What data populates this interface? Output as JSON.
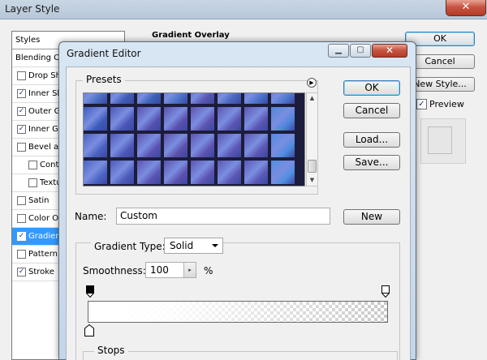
{
  "layer_style": {
    "title": "Layer Style",
    "close_glyph": "✕",
    "styles_header": "Styles",
    "items": [
      {
        "label": "Blending Op",
        "checkbox": false,
        "checked": false,
        "indent": 0,
        "selected": false
      },
      {
        "label": "Drop Sh",
        "checkbox": true,
        "checked": false,
        "indent": 0,
        "selected": false
      },
      {
        "label": "Inner Sh",
        "checkbox": true,
        "checked": true,
        "indent": 0,
        "selected": false
      },
      {
        "label": "Outer Gl",
        "checkbox": true,
        "checked": true,
        "indent": 0,
        "selected": false
      },
      {
        "label": "Inner Gl",
        "checkbox": true,
        "checked": true,
        "indent": 0,
        "selected": false
      },
      {
        "label": "Bevel and",
        "checkbox": true,
        "checked": false,
        "indent": 0,
        "selected": false
      },
      {
        "label": "Conto",
        "checkbox": true,
        "checked": false,
        "indent": 1,
        "selected": false
      },
      {
        "label": "Textu",
        "checkbox": true,
        "checked": false,
        "indent": 1,
        "selected": false
      },
      {
        "label": "Satin",
        "checkbox": true,
        "checked": false,
        "indent": 0,
        "selected": false
      },
      {
        "label": "Color Ov",
        "checkbox": true,
        "checked": false,
        "indent": 0,
        "selected": false
      },
      {
        "label": "Gradien",
        "checkbox": true,
        "checked": true,
        "indent": 0,
        "selected": true
      },
      {
        "label": "Pattern O",
        "checkbox": true,
        "checked": false,
        "indent": 0,
        "selected": false
      },
      {
        "label": "Stroke",
        "checkbox": true,
        "checked": true,
        "indent": 0,
        "selected": false
      }
    ],
    "group_title": "Gradient Overlay",
    "ok_label": "OK",
    "cancel_label": "Cancel",
    "new_style_label": "New Style...",
    "preview_label": "Preview",
    "preview_checked": true
  },
  "gradient_editor": {
    "title": "Gradient Editor",
    "min_glyph": "▁",
    "max_glyph": "▢",
    "close_glyph": "✕",
    "presets_label": "Presets",
    "presets_menu_glyph": "▶",
    "ok_label": "OK",
    "cancel_label": "Cancel",
    "load_label": "Load...",
    "save_label": "Save...",
    "name_label": "Name:",
    "name_value": "Custom",
    "new_label": "New",
    "gradient_type_label": "Gradient Type:",
    "gradient_type_value": "Solid",
    "smoothness_label": "Smoothness:",
    "smoothness_value": "100",
    "smoothness_unit": "%",
    "stepper_glyph": "▸",
    "stops_label": "Stops",
    "scroll_up_glyph": "▲",
    "scroll_down_glyph": "▼",
    "preset_colors": [
      [
        "#4a6fc2",
        "#3f5db6",
        "#3b63b8",
        "#4d72c9",
        "#5a57b0",
        "#4b67c0",
        "#4a74cc",
        "#4f7ad0"
      ],
      [
        "#3d5bbb",
        "#4a55b8",
        "#5650b0",
        "#5a4fae",
        "#5c52b1",
        "#5b55b4",
        "#5a55b2",
        "#4f86dc"
      ],
      [
        "#4a61c1",
        "#4e58b8",
        "#5a52b2",
        "#5c50ad",
        "#5d53b2",
        "#5a55b4",
        "#5b56b4",
        "#4f8ce0"
      ],
      [
        "#4b64c4",
        "#4d5bb9",
        "#5a53b2",
        "#5b51af",
        "#5c54b3",
        "#5a56b4",
        "#5a58b6",
        "#4f8fe2"
      ]
    ]
  }
}
